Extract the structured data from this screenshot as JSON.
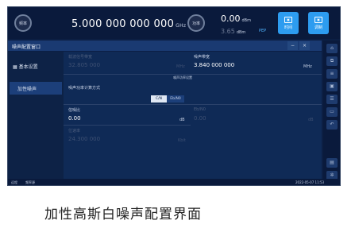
{
  "topbar": {
    "freq_knob": "频率",
    "freq_value": "5.000 000 000 000",
    "freq_unit": "GHz",
    "power_knob": "功率",
    "power_value": "0.00",
    "power_unit": "dBm",
    "power_sub_value": "3.65",
    "power_sub_unit": "dBm",
    "pep_label": "PEP",
    "btn_time": "时间",
    "btn_modulate": "调制",
    "accent_color": "#2d9cf0"
  },
  "panel": {
    "title": "噪声配置窗口",
    "minimize": "−",
    "close": "×"
  },
  "sidebar": {
    "items": [
      {
        "label": "基本设置"
      },
      {
        "label": "加性噪声"
      }
    ]
  },
  "form": {
    "carrier_bw_label": "载波信号带宽",
    "carrier_bw_value": "32.805 000",
    "carrier_bw_unit": "MHz",
    "noise_bw_label": "噪声带宽",
    "noise_bw_value": "3.840 000 000",
    "noise_bw_unit": "MHz",
    "noise_power_hint": "噪声功率设置",
    "calc_mode_label": "噪声功率计算方式",
    "calc_mode_options": [
      "C/N",
      "Eb/N0"
    ],
    "calc_mode_selected": "C/N",
    "cn_label": "信噪比",
    "cn_value": "0.00",
    "cn_unit": "dB",
    "ebno_label": "Eb/N0",
    "ebno_value": "0.00",
    "ebno_unit": "dB",
    "bitrate_label": "位速率",
    "bitrate_value": "24.300 000",
    "bitrate_unit": "Kbit"
  },
  "status": {
    "mode_label": "远程",
    "local_label": "频率源",
    "datetime": "2022-05-07 11:53"
  },
  "caption": "加性高斯白噪声配置界面"
}
